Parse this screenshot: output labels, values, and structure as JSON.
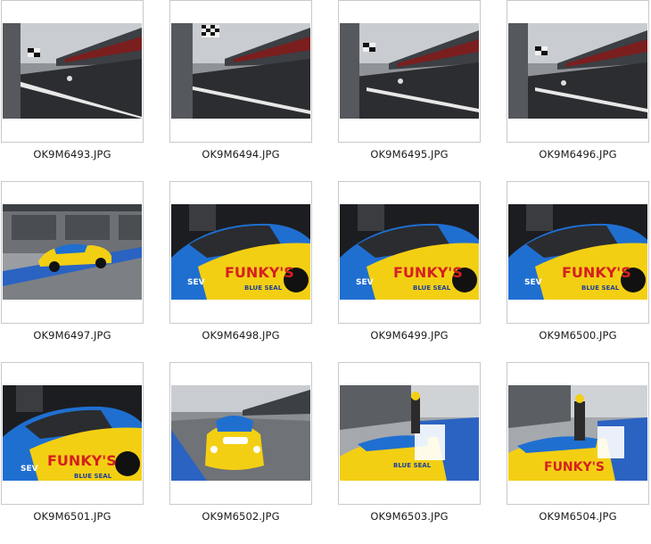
{
  "folder": {
    "files": [
      {
        "name": "OK9M6493.JPG",
        "thumb_icon": "pit-straight-photo-icon"
      },
      {
        "name": "OK9M6494.JPG",
        "thumb_icon": "pit-straight-photo-icon"
      },
      {
        "name": "OK9M6495.JPG",
        "thumb_icon": "pit-straight-photo-icon"
      },
      {
        "name": "OK9M6496.JPG",
        "thumb_icon": "pit-straight-photo-icon"
      },
      {
        "name": "OK9M6497.JPG",
        "thumb_icon": "race-car-pitlane-photo-icon"
      },
      {
        "name": "OK9M6498.JPG",
        "thumb_icon": "race-car-closeup-photo-icon"
      },
      {
        "name": "OK9M6499.JPG",
        "thumb_icon": "race-car-closeup-photo-icon"
      },
      {
        "name": "OK9M6500.JPG",
        "thumb_icon": "race-car-closeup-photo-icon"
      },
      {
        "name": "OK9M6501.JPG",
        "thumb_icon": "race-car-closeup-photo-icon"
      },
      {
        "name": "OK9M6502.JPG",
        "thumb_icon": "race-car-front-photo-icon"
      },
      {
        "name": "OK9M6503.JPG",
        "thumb_icon": "driver-exiting-car-photo-icon"
      },
      {
        "name": "OK9M6504.JPG",
        "thumb_icon": "driver-exiting-car-photo-icon"
      }
    ]
  },
  "colors": {
    "label_text": "#1a1a1a",
    "thumb_border": "#c9c9c9",
    "car_blue": "#1f6fd1",
    "car_yellow": "#f3cf14"
  }
}
